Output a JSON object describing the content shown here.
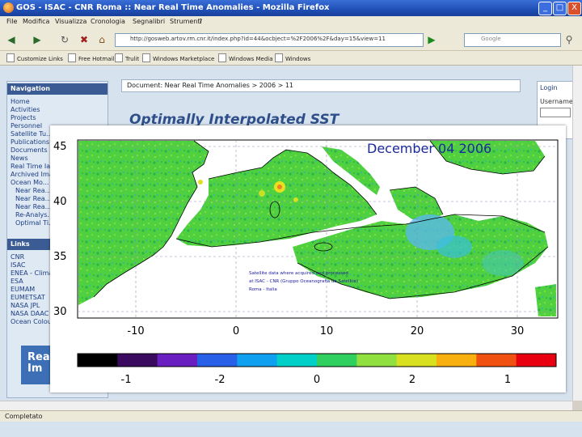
{
  "window": {
    "title": "GOS - ISAC - CNR Roma :: Near Real Time Anomalies - Mozilla Firefox",
    "minimize_glyph": "_",
    "maximize_glyph": "□",
    "close_glyph": "X"
  },
  "menu": [
    "File",
    "Modifica",
    "Visualizza",
    "Cronologia",
    "Segnalibri",
    "Strumenti",
    "?"
  ],
  "address": {
    "url": "http://gosweb.artov.rm.cnr.it/index.php?id=44&ocbject=%2F2006%2F&day=15&view=11",
    "search_placeholder": "Google"
  },
  "bookmarks": [
    "Customize Links",
    "Free Hotmail",
    "Trulit",
    "Windows Marketplace",
    "Windows Media",
    "Windows"
  ],
  "page": {
    "document_bar": "Document: Near Real Time Anomalies > 2006 > 11",
    "logo_text": "Optimally Interpolated SST",
    "banner_text": "Rea\nIm",
    "navigation": {
      "title": "Navigation",
      "items": [
        "Home",
        "Activities",
        "Projects",
        "Personnel",
        "Satellite Tu...",
        "Publications",
        "Documents",
        "News",
        "Real Time Ia...",
        "Archived Ima...",
        "Ocean Mo..."
      ],
      "sub_items": [
        "Near Rea...",
        "Near Rea...",
        "Near Rea...",
        "Re-Analys...",
        "Optimal Ti..."
      ]
    },
    "links": {
      "title": "Links",
      "items": [
        "CNR",
        "ISAC",
        "ENEA - Clima",
        "ESA",
        "EUMAM",
        "EUMETSAT",
        "NASA JPL",
        "NASA DAAC",
        "Ocean Colour"
      ]
    },
    "login": {
      "title": "Login",
      "field_label": "Username"
    }
  },
  "status": {
    "text": "Completato"
  },
  "chart_data": {
    "type": "heatmap",
    "title": "December 04 2006",
    "xlabel": "",
    "ylabel": "",
    "x_ticks": [
      "-10",
      "0",
      "10",
      "20",
      "30"
    ],
    "y_ticks": [
      "45",
      "40",
      "35",
      "30"
    ],
    "xlim": [
      -16,
      37
    ],
    "ylim": [
      29.5,
      46.5
    ],
    "colorbar": {
      "tick_labels": [
        "-1",
        "-2",
        "0",
        "2",
        "1"
      ],
      "colors": [
        "#000000",
        "#3a0a5e",
        "#6a20c0",
        "#2860e8",
        "#10a0f0",
        "#00d0c8",
        "#30d060",
        "#90e040",
        "#d8e020",
        "#f8b010",
        "#f05010",
        "#e80010"
      ]
    },
    "credits": [
      "Satellite data where acquired and processed",
      "at ISAC - CNR (Gruppo Oceanografia da Satellite)",
      "Roma - Italia"
    ],
    "colors": {
      "land": "#ffffff",
      "anomaly_dominant": "#4ed040",
      "coast": "#000000"
    }
  }
}
